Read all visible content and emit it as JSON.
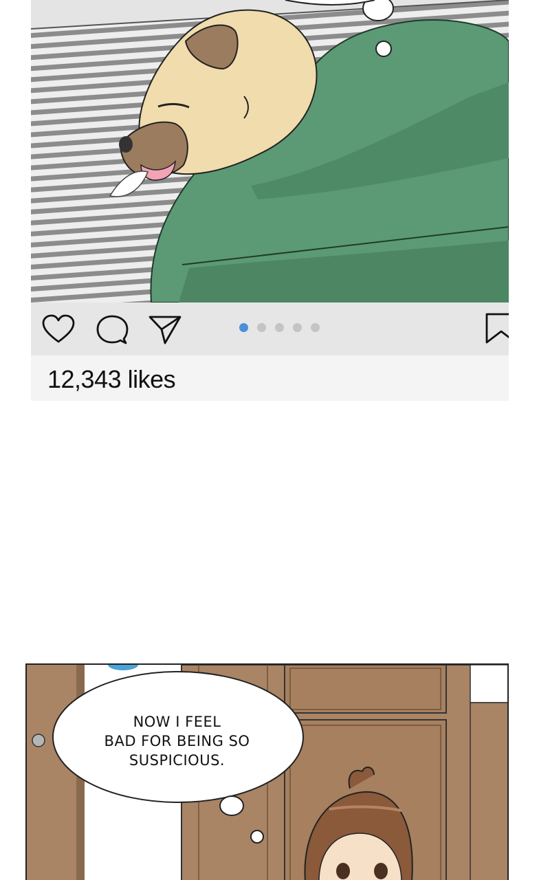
{
  "post": {
    "likes_text": "12,343 likes",
    "carousel": {
      "count": 5,
      "active_index": 0
    },
    "colors": {
      "active_dot": "#4a90d9",
      "inactive_dot": "#c4c4c4",
      "action_bar": "#e6e6e6",
      "likes_bar": "#f4f4f4"
    },
    "icons": [
      "heart-icon",
      "comment-icon",
      "share-icon",
      "bookmark-icon"
    ]
  },
  "panel_bottom": {
    "speech_bubble_lines": [
      "NOW I FEEL",
      "BAD FOR BEING SO",
      "SUSPICIOUS."
    ]
  }
}
